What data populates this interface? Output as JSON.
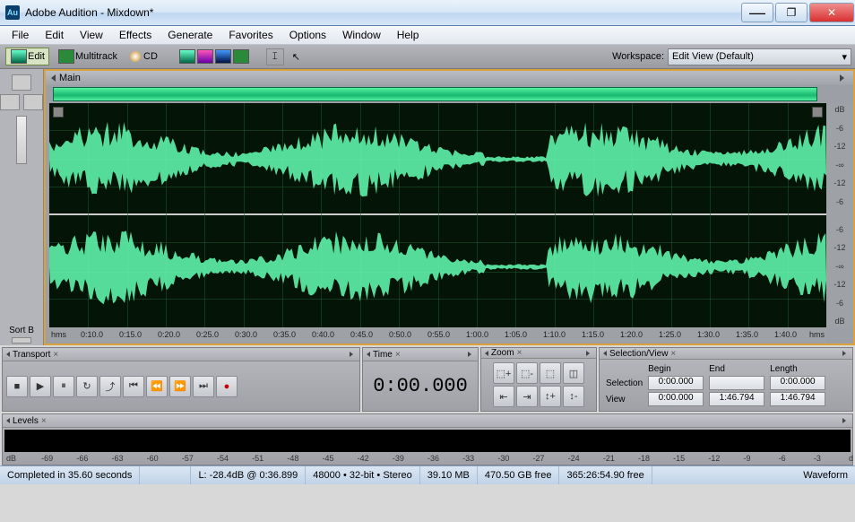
{
  "window": {
    "title": "Adobe Audition - Mixdown*"
  },
  "menu": {
    "items": [
      "File",
      "Edit",
      "View",
      "Effects",
      "Generate",
      "Favorites",
      "Options",
      "Window",
      "Help"
    ]
  },
  "toolbar": {
    "edit": "Edit",
    "multitrack": "Multitrack",
    "cd": "CD",
    "workspace_label": "Workspace:",
    "workspace_value": "Edit View (Default)"
  },
  "wave": {
    "tab": "Main",
    "db_ticks": [
      "dB",
      "-6",
      "-12",
      "-∞",
      "-12",
      "-6",
      "",
      "-6",
      "-12",
      "-∞",
      "-12",
      "-6",
      "dB"
    ],
    "ruler_unit": "hms",
    "ruler_ticks": [
      "0:10.0",
      "0:15.0",
      "0:20.0",
      "0:25.0",
      "0:30.0",
      "0:35.0",
      "0:40.0",
      "0:45.0",
      "0:50.0",
      "0:55.0",
      "1:00.0",
      "1:05.0",
      "1:10.0",
      "1:15.0",
      "1:20.0",
      "1:25.0",
      "1:30.0",
      "1:35.0",
      "1:40.0"
    ]
  },
  "transport": {
    "title": "Transport"
  },
  "time": {
    "title": "Time",
    "value": "0:00.000"
  },
  "zoom": {
    "title": "Zoom"
  },
  "selview": {
    "title": "Selection/View",
    "hdr_begin": "Begin",
    "hdr_end": "End",
    "hdr_len": "Length",
    "row_sel": "Selection",
    "row_view": "View",
    "sel_begin": "0:00.000",
    "sel_end": "",
    "sel_len": "0:00.000",
    "view_begin": "0:00.000",
    "view_end": "1:46.794",
    "view_len": "1:46.794"
  },
  "levels": {
    "title": "Levels",
    "ticks": [
      "dB",
      "-69",
      "-66",
      "-63",
      "-60",
      "-57",
      "-54",
      "-51",
      "-48",
      "-45",
      "-42",
      "-39",
      "-36",
      "-33",
      "-30",
      "-27",
      "-24",
      "-21",
      "-18",
      "-15",
      "-12",
      "-9",
      "-6",
      "-3",
      "d"
    ]
  },
  "status": {
    "completed": "Completed in 35.60 seconds",
    "l_db": "L: -28.4dB @  0:36.899",
    "fmt": "48000 • 32-bit • Stereo",
    "size": "39.10 MB",
    "free1": "470.50 GB free",
    "free2": "365:26:54.90 free",
    "mode": "Waveform"
  }
}
